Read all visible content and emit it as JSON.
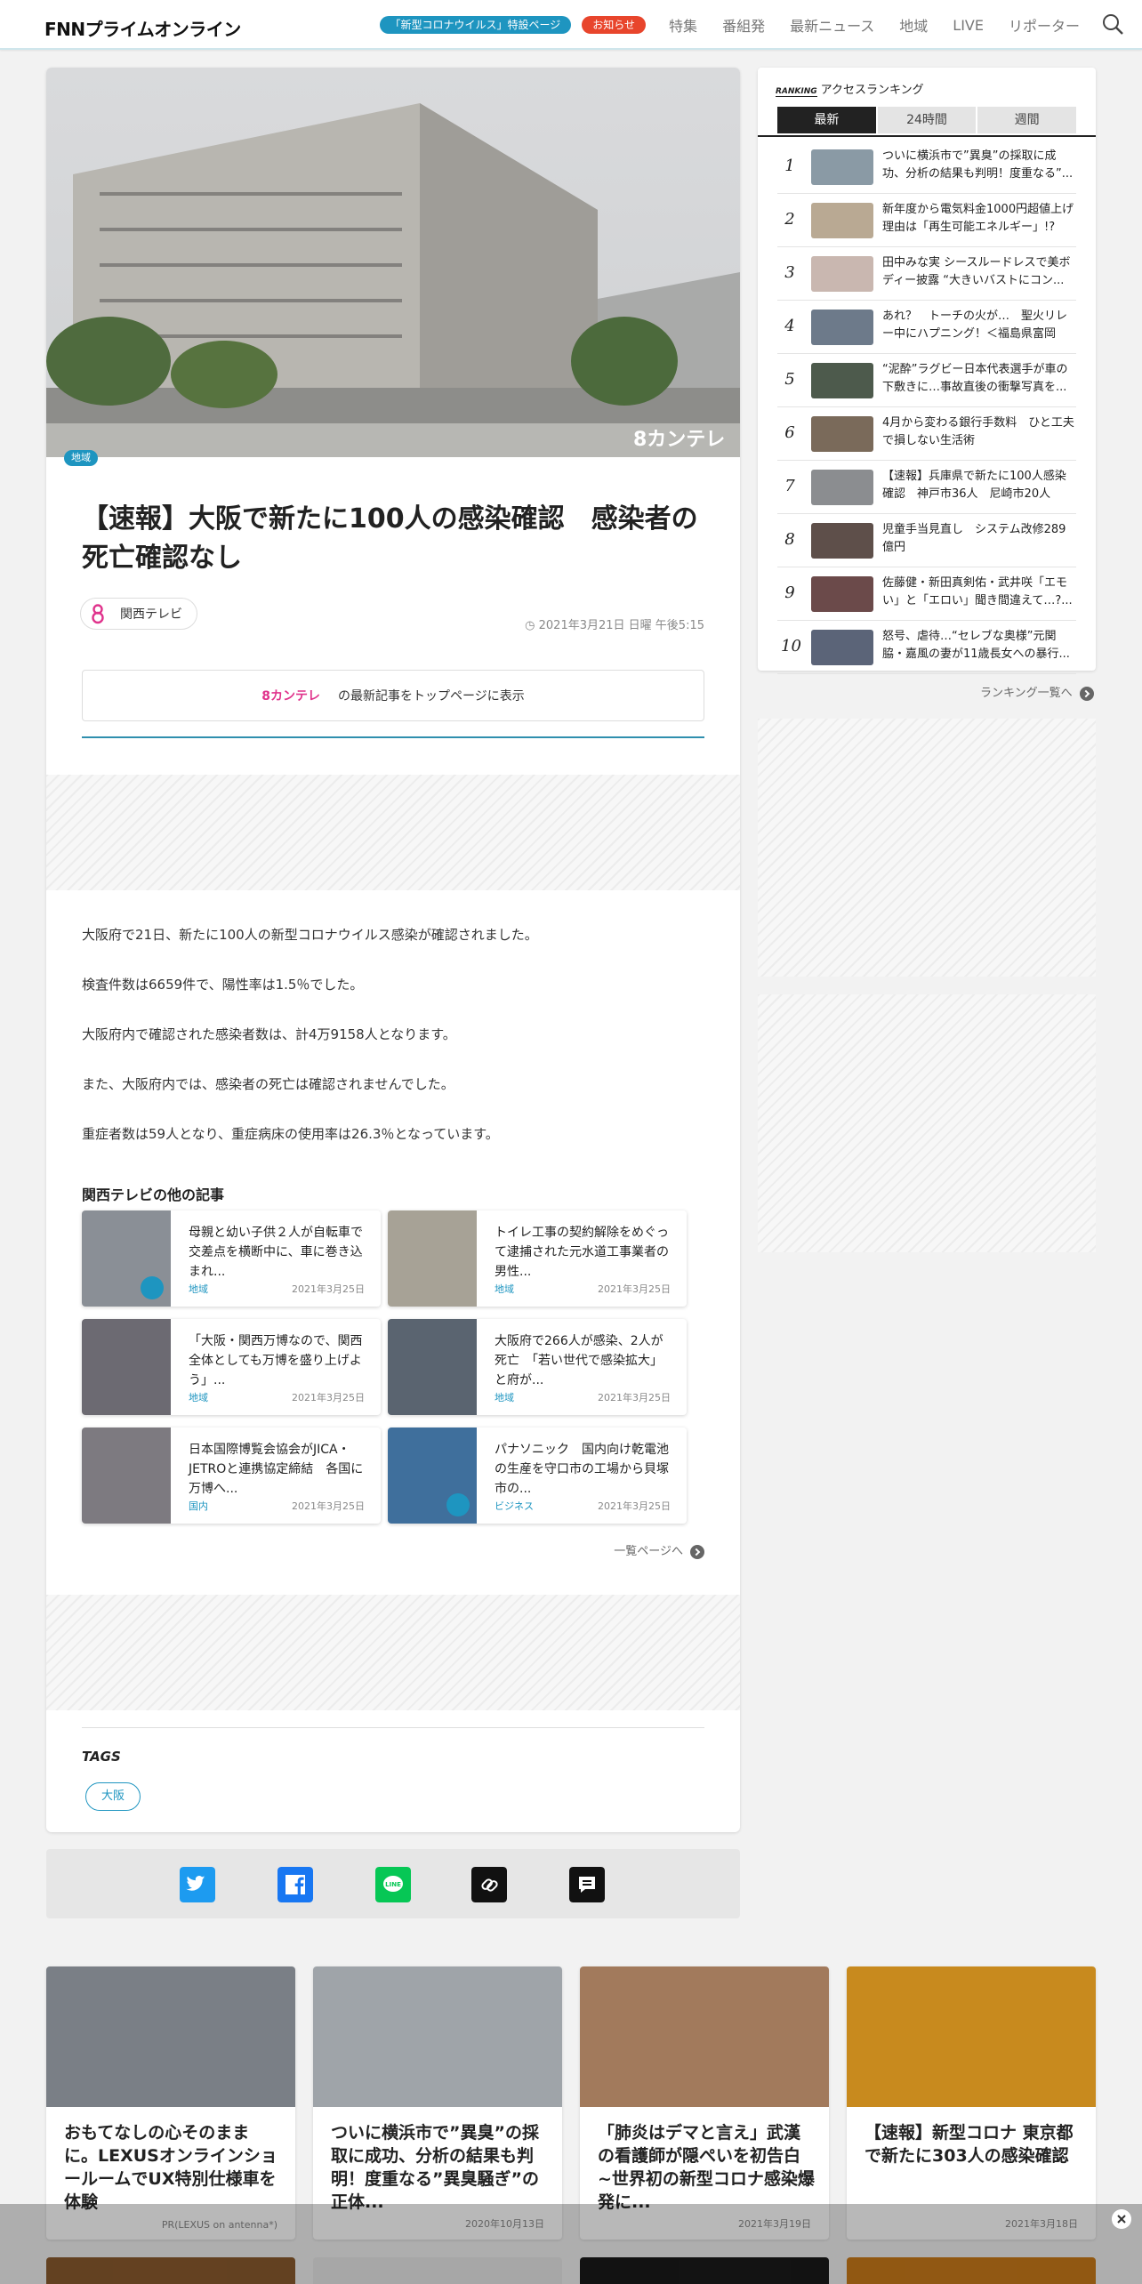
{
  "header": {
    "logo_text": "FNNプライムオンライン",
    "covid_pill": "「新型コロナウイルス」特設ページ",
    "notice_pill": "お知らせ",
    "nav": [
      "特集",
      "番組発",
      "最新ニュース",
      "地域",
      "LIVE",
      "リポーター"
    ]
  },
  "article": {
    "area_badge": "地域",
    "title": "【速報】大阪で新たに100人の感染確認　感染者の死亡確認なし",
    "source": "関西テレビ",
    "date": "2021年3月21日 日曜 午後5:15",
    "top_brand": "カンテレ",
    "top_text": "の最新記事をトップページに表示",
    "paragraphs": [
      "大阪府で21日、新たに100人の新型コロナウイルス感染が確認されました。",
      "検査件数は6659件で、陽性率は1.5％でした。",
      "大阪府内で確認された感染者数は、計4万9158人となります。",
      "また、大阪府内では、感染者の死亡は確認されませんでした。",
      "重症者数は59人となり、重症病床の使用率は26.3％となっています。"
    ],
    "more_heading": "関西テレビの他の記事",
    "related": [
      {
        "text": "母親と幼い子供２人が自転車で交差点を横断中に、車に巻き込まれ...",
        "category": "地域",
        "date": "2021年3月25日",
        "thumb": "#8a8f96",
        "video": true
      },
      {
        "text": "トイレ工事の契約解除をめぐって逮捕された元水道工事業者の男性...",
        "category": "地域",
        "date": "2021年3月25日",
        "thumb": "#a7a296",
        "video": false
      },
      {
        "text": "「大阪・関西万博なので、関西全体としても万博を盛り上げよう」...",
        "category": "地域",
        "date": "2021年3月25日",
        "thumb": "#6c6a72",
        "video": false
      },
      {
        "text": "大阪府で266人が感染、2人が死亡　「若い世代で感染拡大」と府が...",
        "category": "地域",
        "date": "2021年3月25日",
        "thumb": "#5a6470",
        "video": false
      },
      {
        "text": "日本国際博覧会協会がJICA・JETROと連携協定締結　各国に万博へ...",
        "category": "国内",
        "date": "2021年3月25日",
        "thumb": "#7d7a80",
        "video": false
      },
      {
        "text": "パナソニック　国内向け乾電池の生産を守口市の工場から貝塚市の...",
        "category": "ビジネス",
        "date": "2021年3月25日",
        "thumb": "#3f6f9c",
        "video": true
      }
    ],
    "more_link": "一覧ページへ",
    "tags_heading": "TAGS",
    "tags": [
      "大阪"
    ]
  },
  "ranking": {
    "label_small": "RANKING",
    "label": "アクセスランキング",
    "tabs": [
      "最新",
      "24時間",
      "週間"
    ],
    "active_tab": "最新",
    "items": [
      {
        "n": "1",
        "text": "ついに横浜市で”異臭”の採取に成功、分析の結果も判明！度重なる”...",
        "thumb": "#8a9aa5"
      },
      {
        "n": "2",
        "text": "新年度から電気料金1000円超値上げ　理由は「再生可能エネルギー」!?あ...",
        "thumb": "#b9a993"
      },
      {
        "n": "3",
        "text": "田中みな実 シースルードレスで美ボディー披露 “大きいバストにコン...",
        "thumb": "#c9b7b0"
      },
      {
        "n": "4",
        "text": "あれ？　トーチの火が…　聖火リレー中にハプニング！＜福島県富岡町...",
        "thumb": "#6d7a8a"
      },
      {
        "n": "5",
        "text": "“泥酔”ラグビー日本代表選手が車の下敷きに…事故直後の衝撃写真を...",
        "thumb": "#4d5a4c"
      },
      {
        "n": "6",
        "text": "4月から変わる銀行手数料　ひと工夫で損しない生活術",
        "thumb": "#7a6a5a"
      },
      {
        "n": "7",
        "text": "【速報】兵庫県で新たに100人感染確認　神戸市36人　尼崎市20人　西...",
        "thumb": "#8b8d90"
      },
      {
        "n": "8",
        "text": "児童手当見直し　システム改修289億円",
        "thumb": "#5e4f4a"
      },
      {
        "n": "9",
        "text": "佐藤健・新田真剣佑・武井咲「エモい」と「エロい」聞き間違えて…?...",
        "thumb": "#6b4a4a"
      },
      {
        "n": "10",
        "text": "怒号、虐待…“セレブな奥様”元関脇・嘉風の妻が11歳長女への暴行...",
        "thumb": "#5b6478"
      }
    ],
    "more_link": "ランキング一覧へ"
  },
  "cards": [
    {
      "title": "おもてなしの心そのままに。LEXUSオンラインショールームでUX特別仕様車を体験",
      "meta": "PR(LEXUS on antenna*)",
      "image": "#7a7f86"
    },
    {
      "title": "ついに横浜市で”異臭”の採取に成功、分析の結果も判明！度重なる”異臭騒ぎ”の正体...",
      "meta": "2020年10月13日",
      "image": "#9fa4a9"
    },
    {
      "title": "「肺炎はデマと言え」武漢の看護師が隠ぺいを初告白　~世界初の新型コロナ感染爆発に...",
      "meta": "2021年3月19日",
      "image": "#a27a5c"
    },
    {
      "title": "【速報】新型コロナ 東京都で新たに303人の感染確認",
      "meta": "2021年3月18日",
      "image": "#c88a1e"
    }
  ],
  "colors": {
    "accent": "#1e95c0",
    "alert": "#e8452c",
    "brand_pink": "#e0338c"
  }
}
